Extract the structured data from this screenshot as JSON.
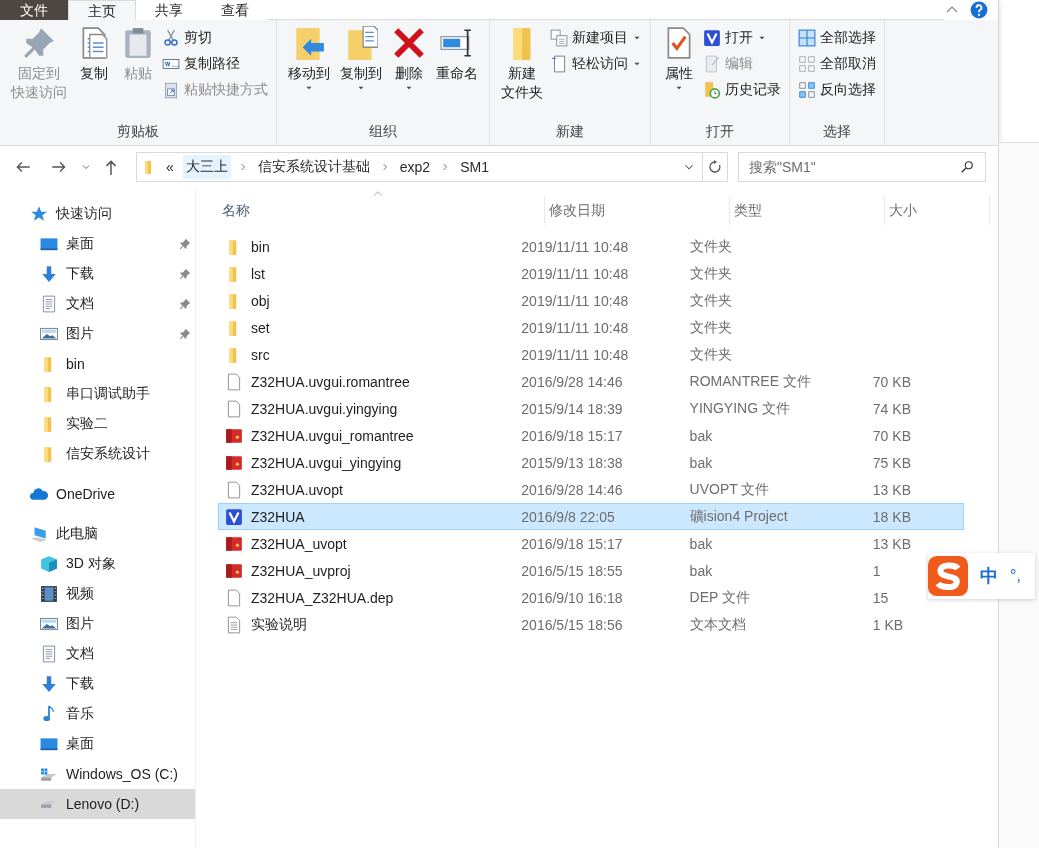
{
  "tabs": [
    {
      "label": "文件",
      "kind": "file",
      "selected": false
    },
    {
      "label": "主页",
      "kind": "tab",
      "selected": true
    },
    {
      "label": "共享",
      "kind": "tab",
      "selected": false
    },
    {
      "label": "查看",
      "kind": "tab",
      "selected": false
    }
  ],
  "ribbon": [
    {
      "label": "剪贴板",
      "columns": [
        {
          "kind": "large",
          "items": [
            {
              "lines": [
                "固定到",
                "快速访问"
              ],
              "kind": "pin",
              "disabled": true,
              "dropdown": false
            }
          ]
        },
        {
          "kind": "large",
          "items": [
            {
              "lines": [
                "复制"
              ],
              "kind": "copy",
              "disabled": false,
              "dropdown": false
            }
          ]
        },
        {
          "kind": "large",
          "items": [
            {
              "lines": [
                "粘贴"
              ],
              "kind": "paste",
              "disabled": true,
              "dropdown": false
            }
          ]
        },
        {
          "kind": "stack",
          "items": [
            {
              "lines": [
                "剪切"
              ],
              "kind": "cut",
              "disabled": false,
              "dropdown": false
            },
            {
              "lines": [
                "复制路径"
              ],
              "kind": "copypath",
              "disabled": false,
              "dropdown": false
            },
            {
              "lines": [
                "粘贴快捷方式"
              ],
              "kind": "shortcut",
              "disabled": true,
              "dropdown": false
            }
          ]
        }
      ]
    },
    {
      "label": "组织",
      "columns": [
        {
          "kind": "large",
          "items": [
            {
              "lines": [
                "移动到"
              ],
              "kind": "moveto",
              "disabled": false,
              "dropdown": true
            }
          ]
        },
        {
          "kind": "large",
          "items": [
            {
              "lines": [
                "复制到"
              ],
              "kind": "copyto",
              "disabled": false,
              "dropdown": true
            }
          ]
        },
        {
          "kind": "large",
          "items": [
            {
              "lines": [
                "删除"
              ],
              "kind": "delete",
              "disabled": false,
              "dropdown": true
            }
          ]
        },
        {
          "kind": "large",
          "items": [
            {
              "lines": [
                "重命名"
              ],
              "kind": "rename",
              "disabled": false,
              "dropdown": false
            }
          ]
        }
      ]
    },
    {
      "label": "新建",
      "columns": [
        {
          "kind": "large",
          "items": [
            {
              "lines": [
                "新建",
                "文件夹"
              ],
              "kind": "newfolder",
              "disabled": false,
              "dropdown": false
            }
          ]
        },
        {
          "kind": "stack",
          "items": [
            {
              "lines": [
                "新建项目"
              ],
              "kind": "newitem",
              "disabled": false,
              "dropdown": true
            },
            {
              "lines": [
                "轻松访问"
              ],
              "kind": "easyaccess",
              "disabled": false,
              "dropdown": true
            }
          ]
        }
      ]
    },
    {
      "label": "打开",
      "columns": [
        {
          "kind": "large",
          "items": [
            {
              "lines": [
                "属性"
              ],
              "kind": "properties",
              "disabled": false,
              "dropdown": true
            }
          ]
        },
        {
          "kind": "stack",
          "items": [
            {
              "lines": [
                "打开"
              ],
              "kind": "open",
              "disabled": false,
              "dropdown": true
            },
            {
              "lines": [
                "编辑"
              ],
              "kind": "edit",
              "disabled": true,
              "dropdown": false
            },
            {
              "lines": [
                "历史记录"
              ],
              "kind": "history",
              "disabled": false,
              "dropdown": false
            }
          ]
        }
      ]
    },
    {
      "label": "选择",
      "columns": [
        {
          "kind": "stack",
          "items": [
            {
              "lines": [
                "全部选择"
              ],
              "kind": "selectall",
              "disabled": false,
              "dropdown": false
            },
            {
              "lines": [
                "全部取消"
              ],
              "kind": "selectnone",
              "disabled": false,
              "dropdown": false
            },
            {
              "lines": [
                "反向选择"
              ],
              "kind": "invert",
              "disabled": false,
              "dropdown": false
            }
          ]
        }
      ]
    }
  ],
  "address": {
    "overflow": "«",
    "segments": [
      "大三上",
      "信安系统设计基础",
      "exp2",
      "SM1"
    ]
  },
  "search": {
    "placeholder": "搜索\"SM1\""
  },
  "nav": [
    {
      "label": "快速访问",
      "kind": "star",
      "selected": false,
      "children": [
        {
          "label": "桌面",
          "kind": "desktop",
          "pinned": true,
          "selected": false
        },
        {
          "label": "下载",
          "kind": "download",
          "pinned": true,
          "selected": false
        },
        {
          "label": "文档",
          "kind": "docs",
          "pinned": true,
          "selected": false
        },
        {
          "label": "图片",
          "kind": "pictures",
          "pinned": true,
          "selected": false
        },
        {
          "label": "bin",
          "kind": "folder",
          "pinned": false,
          "selected": false
        },
        {
          "label": "串口调试助手",
          "kind": "folder",
          "pinned": false,
          "selected": false
        },
        {
          "label": "实验二",
          "kind": "folder",
          "pinned": false,
          "selected": false
        },
        {
          "label": "信安系统设计",
          "kind": "folder",
          "pinned": false,
          "selected": false
        }
      ]
    },
    {
      "label": "OneDrive",
      "kind": "cloud",
      "selected": false
    },
    {
      "label": "此电脑",
      "kind": "pc",
      "selected": false,
      "children": [
        {
          "label": "3D 对象",
          "kind": "cube",
          "pinned": false,
          "selected": false
        },
        {
          "label": "视频",
          "kind": "video",
          "pinned": false,
          "selected": false
        },
        {
          "label": "图片",
          "kind": "pictures",
          "pinned": false,
          "selected": false
        },
        {
          "label": "文档",
          "kind": "docs",
          "pinned": false,
          "selected": false
        },
        {
          "label": "下载",
          "kind": "download",
          "pinned": false,
          "selected": false
        },
        {
          "label": "音乐",
          "kind": "music",
          "pinned": false,
          "selected": false
        },
        {
          "label": "桌面",
          "kind": "desktop",
          "pinned": false,
          "selected": false
        },
        {
          "label": "Windows_OS (C:)",
          "kind": "drivec",
          "pinned": false,
          "selected": false
        },
        {
          "label": "Lenovo (D:)",
          "kind": "drive",
          "pinned": false,
          "selected": true
        }
      ]
    }
  ],
  "table": {
    "columns": [
      "名称",
      "修改日期",
      "类型",
      "大小"
    ],
    "rows": [
      {
        "name": "bin",
        "kind": "folder",
        "date": "2019/11/11 10:48",
        "type": "文件夹",
        "selected": false
      },
      {
        "name": "lst",
        "kind": "folder",
        "date": "2019/11/11 10:48",
        "type": "文件夹",
        "selected": false
      },
      {
        "name": "obj",
        "kind": "folder",
        "date": "2019/11/11 10:48",
        "type": "文件夹",
        "selected": false
      },
      {
        "name": "set",
        "kind": "folder",
        "date": "2019/11/11 10:48",
        "type": "文件夹",
        "selected": false
      },
      {
        "name": "src",
        "kind": "folder",
        "date": "2019/11/11 10:48",
        "type": "文件夹",
        "selected": false
      },
      {
        "name": "Z32HUA.uvgui.romantree",
        "kind": "file",
        "date": "2016/9/28 14:46",
        "type": "ROMANTREE 文件",
        "size": "70 KB",
        "selected": false
      },
      {
        "name": "Z32HUA.uvgui.yingying",
        "kind": "file",
        "date": "2015/9/14 18:39",
        "type": "YINGYING 文件",
        "size": "74 KB",
        "selected": false
      },
      {
        "name": "Z32HUA.uvgui_romantree",
        "kind": "bak",
        "date": "2016/9/18 15:17",
        "type": "bak",
        "size": "70 KB",
        "selected": false
      },
      {
        "name": "Z32HUA.uvgui_yingying",
        "kind": "bak",
        "date": "2015/9/13 18:38",
        "type": "bak",
        "size": "75 KB",
        "selected": false
      },
      {
        "name": "Z32HUA.uvopt",
        "kind": "file",
        "date": "2016/9/28 14:46",
        "type": "UVOPT 文件",
        "size": "13 KB",
        "selected": false
      },
      {
        "name": "Z32HUA",
        "kind": "project",
        "date": "2016/9/8 22:05",
        "type": "礦ision4 Project",
        "size": "18 KB",
        "selected": true
      },
      {
        "name": "Z32HUA_uvopt",
        "kind": "bak",
        "date": "2016/9/18 15:17",
        "type": "bak",
        "size": "13 KB",
        "selected": false
      },
      {
        "name": "Z32HUA_uvproj",
        "kind": "bak",
        "date": "2016/5/15 18:55",
        "type": "bak",
        "size": "1",
        "selected": false
      },
      {
        "name": "Z32HUA_Z32HUA.dep",
        "kind": "file",
        "date": "2016/9/10 16:18",
        "type": "DEP 文件",
        "size": "15",
        "selected": false
      },
      {
        "name": "实验说明",
        "kind": "text",
        "date": "2016/5/15 18:56",
        "type": "文本文档",
        "size": "1 KB",
        "selected": false
      }
    ]
  },
  "ime": {
    "mode": "中",
    "punct": "°,"
  }
}
